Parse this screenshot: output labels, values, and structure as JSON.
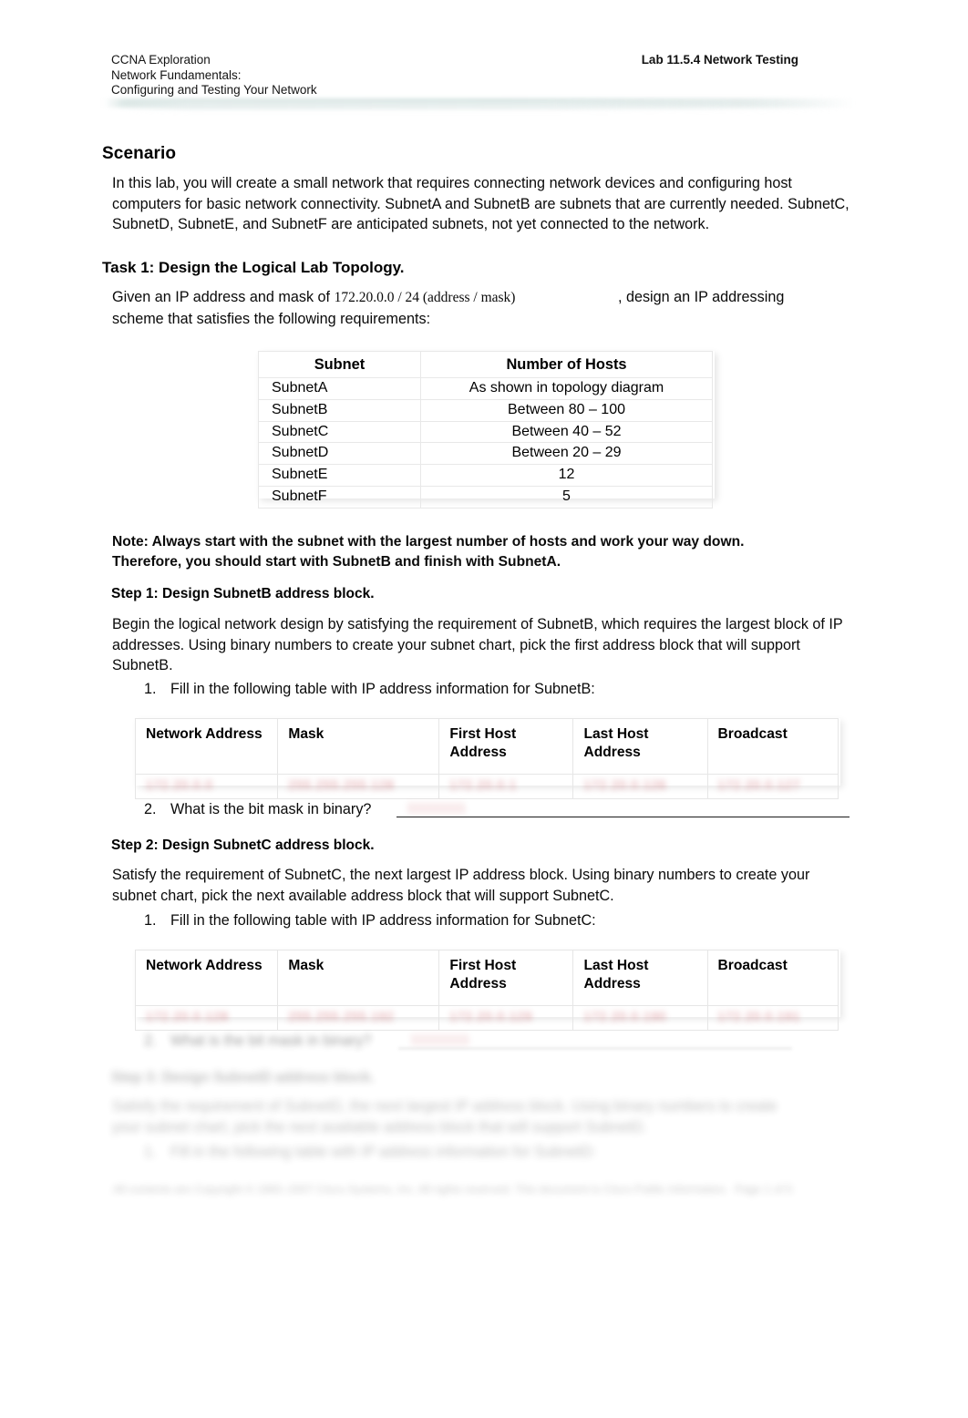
{
  "header": {
    "line1": "CCNA Exploration",
    "line2": "Network Fundamentals:",
    "line3": "Configuring and Testing Your Network",
    "right": "Lab 11.5.4 Network Testing"
  },
  "scenario": {
    "heading": "Scenario",
    "body": "In this lab, you will create a small network that requires connecting network devices and configuring host computers for basic network connectivity. SubnetA and SubnetB are subnets that are currently needed. SubnetC, SubnetD, SubnetE, and SubnetF are anticipated subnets, not yet connected to the network."
  },
  "task1": {
    "heading": "Task 1: Design the Logical Lab Topology.",
    "intro_before": "Given an IP address and mask of",
    "intro_value": "172.20.0.0 / 24 (address / mask)",
    "intro_after": ", design an IP addressing",
    "intro_line2": "scheme that satisfies the following requirements:"
  },
  "requirements_table": {
    "columns": [
      "Subnet",
      "Number of Hosts"
    ],
    "rows": [
      {
        "subnet": "SubnetA",
        "hosts": "As shown in topology diagram"
      },
      {
        "subnet": "SubnetB",
        "hosts": "Between 80 – 100"
      },
      {
        "subnet": "SubnetC",
        "hosts": "Between 40 – 52"
      },
      {
        "subnet": "SubnetD",
        "hosts": "Between 20 – 29"
      },
      {
        "subnet": "SubnetE",
        "hosts": "12"
      },
      {
        "subnet": "SubnetF",
        "hosts": "5"
      }
    ]
  },
  "note": {
    "line1": "Note: Always start with the subnet with the largest number of hosts and work your way down.",
    "line2": "Therefore, you should start with SubnetB and finish with SubnetA."
  },
  "step1": {
    "heading": "Step 1: Design SubnetB address block.",
    "body": "Begin the logical network design by satisfying the requirement of SubnetB, which requires the largest block of IP addresses. Using binary numbers to create your subnet chart, pick the first address block that will support SubnetB.",
    "item1_num": "1.",
    "item1_text": "Fill in the following table with IP address information for SubnetB:",
    "item2_num": "2.",
    "item2_text": "What is the bit mask in binary?",
    "item2_answer": "11111111"
  },
  "ip_table_b": {
    "columns": [
      "Network Address",
      "Mask",
      "First Host Address",
      "Last Host Address",
      "Broadcast"
    ],
    "answers": [
      "172.20.0.0",
      "255.255.255.128",
      "172.20.0.1",
      "172.20.0.126",
      "172.20.0.127"
    ]
  },
  "step2": {
    "heading": "Step 2: Design SubnetC address block.",
    "body": "Satisfy the requirement of SubnetC, the next largest IP address block. Using binary numbers to create your subnet chart, pick the next available address block that will support SubnetC.",
    "item1_num": "1.",
    "item1_text": "Fill in the following table with IP address information for SubnetC:",
    "item2_num": "2.",
    "item2_text": "What is the bit mask in binary?",
    "item2_answer": "11111111"
  },
  "ip_table_c": {
    "columns": [
      "Network Address",
      "Mask",
      "First Host Address",
      "Last Host Address",
      "Broadcast"
    ],
    "answers": [
      "172.20.0.128",
      "255.255.255.192",
      "172.20.0.129",
      "172.20.0.190",
      "172.20.0.191"
    ]
  },
  "step3": {
    "heading": "Step 3: Design SubnetD address block.",
    "body_line1": "Satisfy the requirement of SubnetD, the next largest IP address block. Using binary numbers to create",
    "body_line2": "your subnet chart, pick the next available address block that will support SubnetD.",
    "item1_num": "1.",
    "item1_text": "Fill in the following table with IP address information for SubnetD:"
  },
  "footer": {
    "copyright": "All contents are Copyright © 1992–2007 Cisco Systems, Inc. All rights reserved. This document is Cisco Public Information.",
    "page": "Page 1 of 5"
  }
}
